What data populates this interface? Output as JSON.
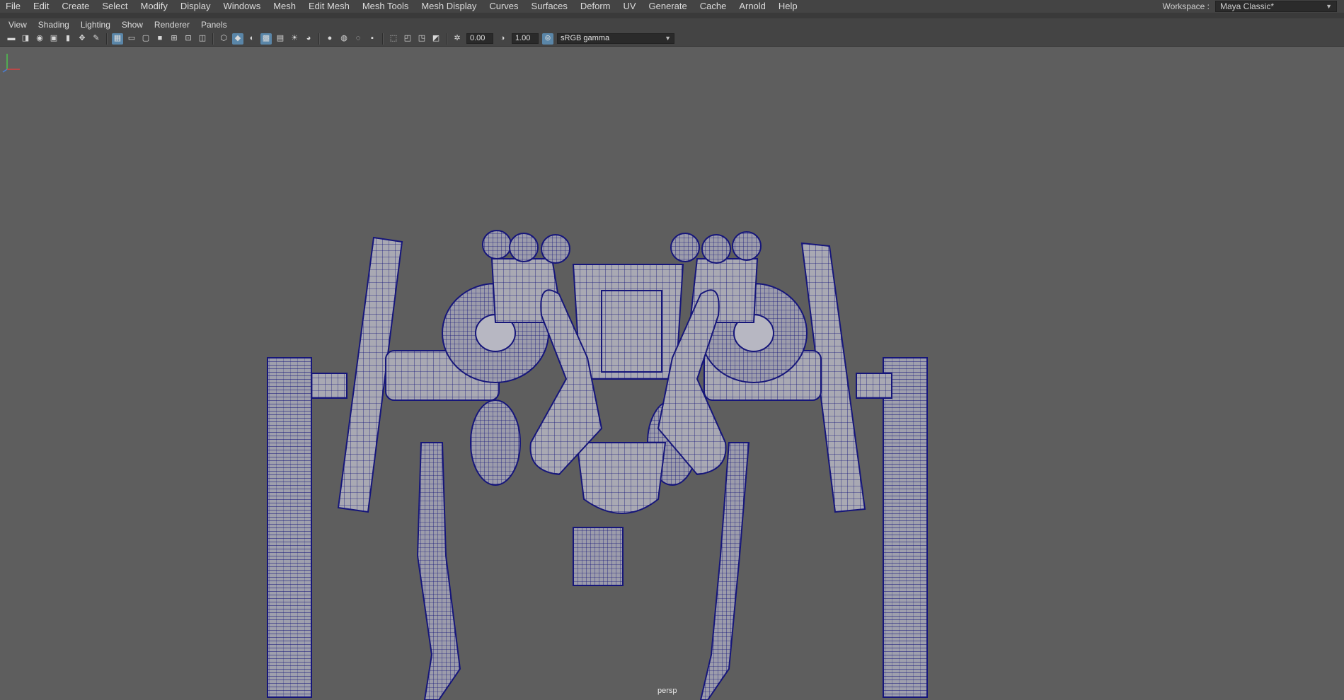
{
  "main_menu": {
    "items": [
      "File",
      "Edit",
      "Create",
      "Select",
      "Modify",
      "Display",
      "Windows",
      "Mesh",
      "Edit Mesh",
      "Mesh Tools",
      "Mesh Display",
      "Curves",
      "Surfaces",
      "Deform",
      "UV",
      "Generate",
      "Cache",
      "Arnold",
      "Help"
    ]
  },
  "workspace": {
    "label": "Workspace :",
    "value": "Maya Classic*"
  },
  "panel_menu": {
    "items": [
      "View",
      "Shading",
      "Lighting",
      "Show",
      "Renderer",
      "Panels"
    ]
  },
  "toolbar": {
    "exposure_value": "0.00",
    "gamma_value": "1.00",
    "color_space": "sRGB gamma"
  },
  "viewport": {
    "camera_label": "persp",
    "background_color": "#5e5e5e",
    "wireframe_color": "#16167a",
    "surface_color": "#a9a9b3"
  }
}
